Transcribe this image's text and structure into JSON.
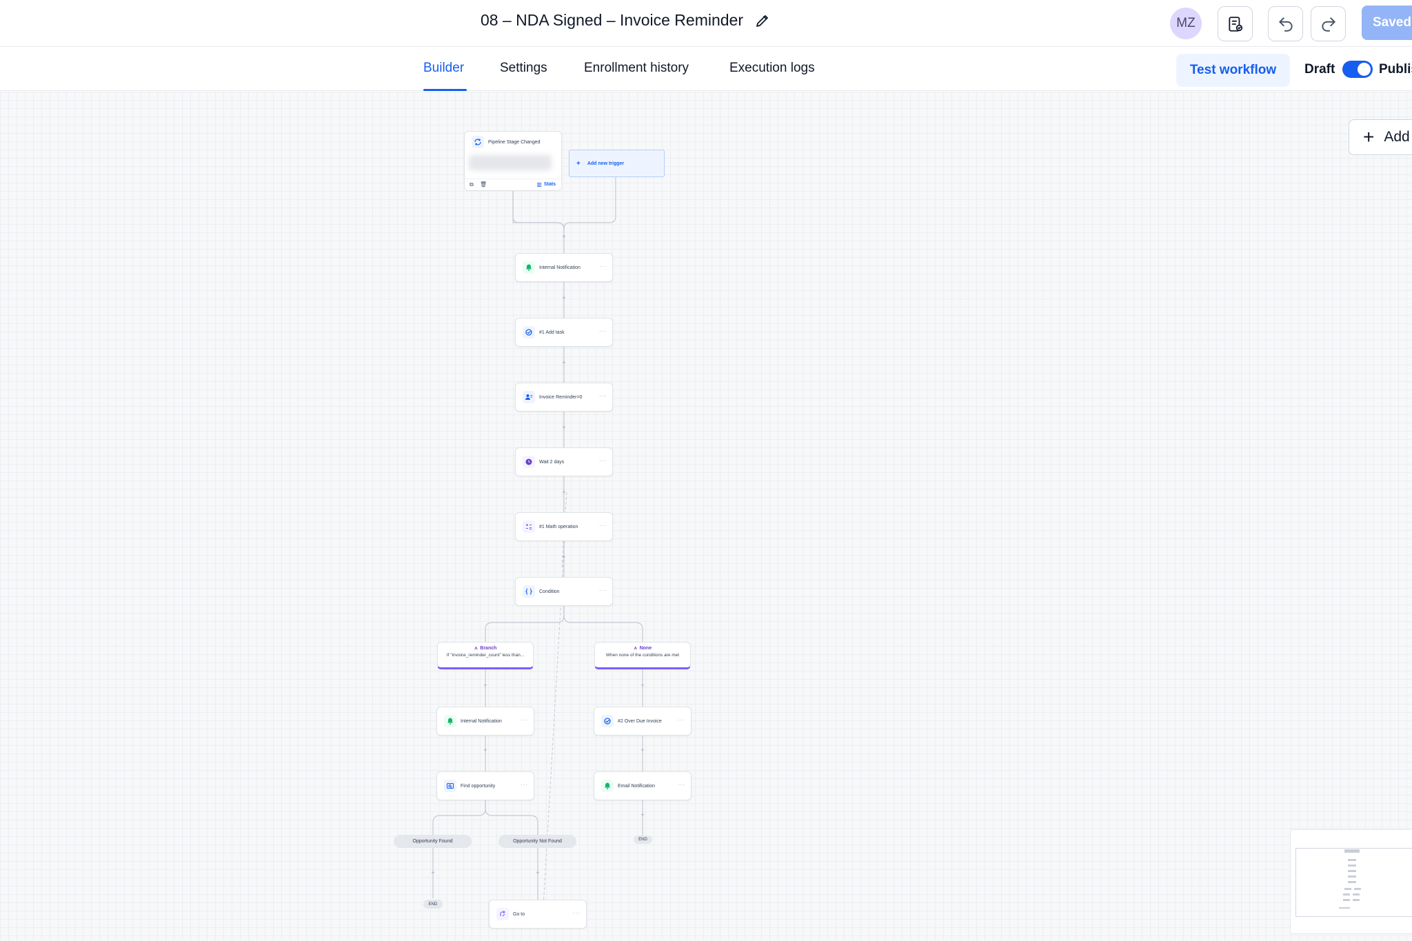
{
  "header": {
    "title": "08 – NDA Signed – Invoice Reminder",
    "avatar_initials": "MZ",
    "saved_label": "Saved"
  },
  "tabs": [
    {
      "label": "Builder",
      "active": true
    },
    {
      "label": "Settings",
      "active": false
    },
    {
      "label": "Enrollment history",
      "active": false
    },
    {
      "label": "Execution logs",
      "active": false
    }
  ],
  "actions": {
    "test_label": "Test workflow",
    "draft_label": "Draft",
    "publish_label": "Publish",
    "publish_toggle_on": true
  },
  "canvas": {
    "add_button_label": "Add",
    "trigger": {
      "label": "Pipeline Stage Changed",
      "stats_label": "Stats",
      "add_trigger_label": "Add new trigger"
    },
    "nodes": [
      {
        "label": "Internal Notification",
        "icon": "bell-icon"
      },
      {
        "label": "#1 Add task",
        "icon": "task-check-icon"
      },
      {
        "label": "Invoice Reminder=0",
        "icon": "contact-field-icon"
      },
      {
        "label": "Wait 2 days",
        "icon": "clock-icon"
      },
      {
        "label": "#1 Math operation",
        "icon": "math-icon"
      },
      {
        "label": "Condition",
        "icon": "braces-icon"
      }
    ],
    "branches": [
      {
        "name": "Branch",
        "description": "If \"invoice_reminder_count\" less than..."
      },
      {
        "name": "None",
        "description": "When none of the conditions are met"
      }
    ],
    "branch_nodes": {
      "left": [
        {
          "label": "Internal Notification",
          "icon": "bell-icon"
        },
        {
          "label": "Find opportunity",
          "icon": "search-record-icon"
        }
      ],
      "right": [
        {
          "label": "#2 Over Due Invoice",
          "icon": "task-check-icon"
        },
        {
          "label": "Email Notification",
          "icon": "bell-icon"
        }
      ]
    },
    "outcomes": [
      "Opportunity Found",
      "Opportunity Not Found"
    ],
    "end_label": "END",
    "goto_label": "Go to"
  },
  "colors": {
    "accent": "#155eef",
    "branch_accent": "#7c5cff",
    "notification_green": "#12b76a",
    "wait_purple": "#6941c6"
  }
}
